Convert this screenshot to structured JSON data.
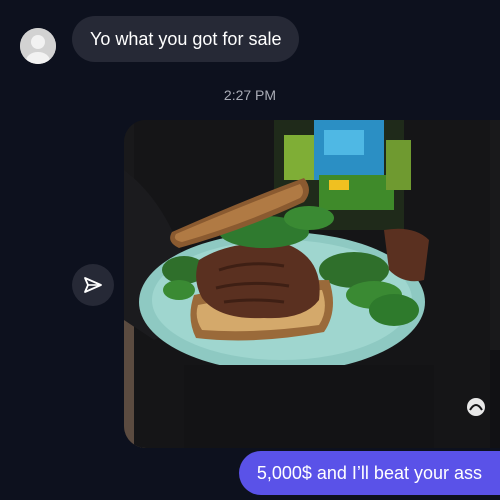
{
  "chat": {
    "incoming_message": "Yo what you got for sale",
    "timestamp": "2:27 PM",
    "outgoing_message": "5,000$ and I’ll beat your ass"
  },
  "icons": {
    "avatar": "default-user-avatar",
    "share": "share-paper-plane-icon"
  },
  "colors": {
    "background": "#0d111e",
    "incoming_bubble": "#262936",
    "outgoing_bubble": "#5a52e8",
    "timestamp_text": "#a9acb6"
  }
}
